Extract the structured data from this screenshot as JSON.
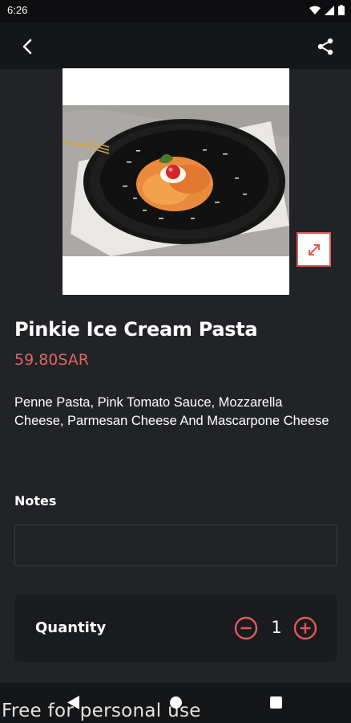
{
  "status_bar": {
    "time": "6:26"
  },
  "icons": {
    "back": "back-arrow-icon",
    "share": "share-icon",
    "expand": "expand-icon",
    "minus": "minus-circle-icon",
    "plus": "plus-circle-icon"
  },
  "product": {
    "name": "Pinkie Ice Cream Pasta",
    "price": "59.80SAR",
    "description": "Penne Pasta, Pink Tomato Sauce, Mozzarella Cheese, Parmesan Cheese And Mascarpone Cheese"
  },
  "notes": {
    "label": "Notes",
    "value": ""
  },
  "quantity": {
    "label": "Quantity",
    "value": "1"
  },
  "watermark": "Free for personal use",
  "colors": {
    "accent": "#e05a5a",
    "background": "#222326",
    "app_bar": "#151618"
  }
}
